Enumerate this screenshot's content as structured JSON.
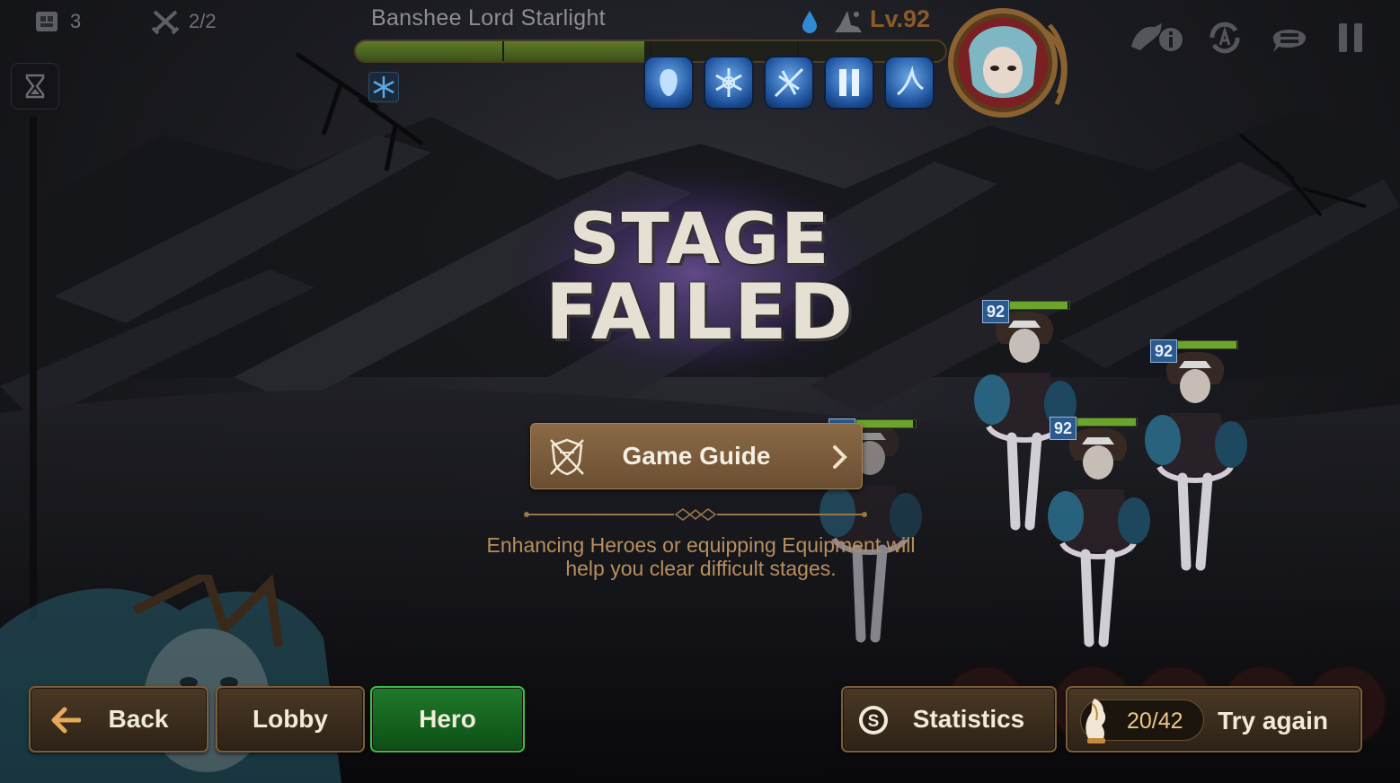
{
  "hud": {
    "team_count": "3",
    "battle_count": "2/2"
  },
  "boss": {
    "name": "Banshee Lord Starlight",
    "level": "Lv.92",
    "hp_fraction": 0.49,
    "element": "ice",
    "skill_icons": [
      "skill-1-icon",
      "skill-2-icon",
      "skill-3-icon",
      "skill-4-icon",
      "skill-5-icon"
    ]
  },
  "result": {
    "title_line1": "STAGE",
    "title_line2": "FAILED",
    "guide_button": "Game Guide",
    "hint": "Enhancing Heroes or equipping Equipment will help you clear difficult stages."
  },
  "enemies": [
    {
      "level": "92",
      "hp": 0.95
    },
    {
      "level": "92",
      "hp": 0.97
    },
    {
      "level": "92",
      "hp": 0.98
    },
    {
      "level": "92",
      "hp": 0.98
    }
  ],
  "buttons": {
    "back": "Back",
    "lobby": "Lobby",
    "hero": "Hero",
    "statistics": "Statistics",
    "energy": "20/42",
    "try_again": "Try again"
  },
  "colors": {
    "accent_gold": "#b88f5e",
    "hero_button_green": "#1f7a2a",
    "boss_level_orange": "#8a5a2a",
    "enemy_level_blue": "#2d5a8e"
  }
}
